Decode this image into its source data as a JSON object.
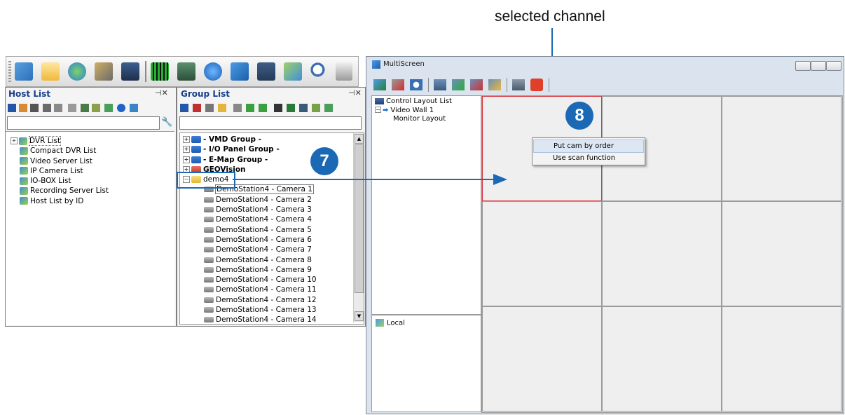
{
  "callout_text": "selected channel",
  "main_toolbar": {
    "icons": [
      "network-icon",
      "folder-icon",
      "globe-icon",
      "emap-icon",
      "monitor-icon",
      "level-meter-icon",
      "dvr-icon",
      "download-icon",
      "multiscreen-icon",
      "screen-icon",
      "scan-icon",
      "search-icon",
      "keypad-icon"
    ]
  },
  "host_list": {
    "title": "Host List",
    "pin": "⊣✕",
    "items": [
      "DVR List",
      "Compact DVR List",
      "Video Server List",
      "IP Camera List",
      "IO-BOX List",
      "Recording Server List",
      "Host List by ID"
    ]
  },
  "group_list": {
    "title": "Group List",
    "pin": "⊣✕",
    "groups": [
      "- VMD Group -",
      "- I/O Panel Group -",
      "- E-Map Group -",
      "GEOVision"
    ],
    "selected_group": "demo4",
    "cameras": [
      "DemoStation4 - Camera 1",
      "DemoStation4 - Camera 2",
      "DemoStation4 - Camera 3",
      "DemoStation4 - Camera 4",
      "DemoStation4 - Camera 5",
      "DemoStation4 - Camera 6",
      "DemoStation4 - Camera 7",
      "DemoStation4 - Camera 8",
      "DemoStation4 - Camera 9",
      "DemoStation4 - Camera 10",
      "DemoStation4 - Camera 11",
      "DemoStation4 - Camera 12",
      "DemoStation4 - Camera 13",
      "DemoStation4 - Camera 14"
    ]
  },
  "multiscreen": {
    "title": "MultiScreen",
    "tree_root": "Control Layout List",
    "tree_child": "Video Wall 1",
    "tree_leaf": "Monitor Layout",
    "local_label": "Local",
    "context_menu": [
      "Put cam by order",
      "Use scan function"
    ]
  },
  "badges": {
    "step7": "7",
    "step8": "8"
  },
  "colors": {
    "accent_blue": "#1b69b5",
    "highlight_red": "#d9363e",
    "title_blue": "#163f8c"
  }
}
